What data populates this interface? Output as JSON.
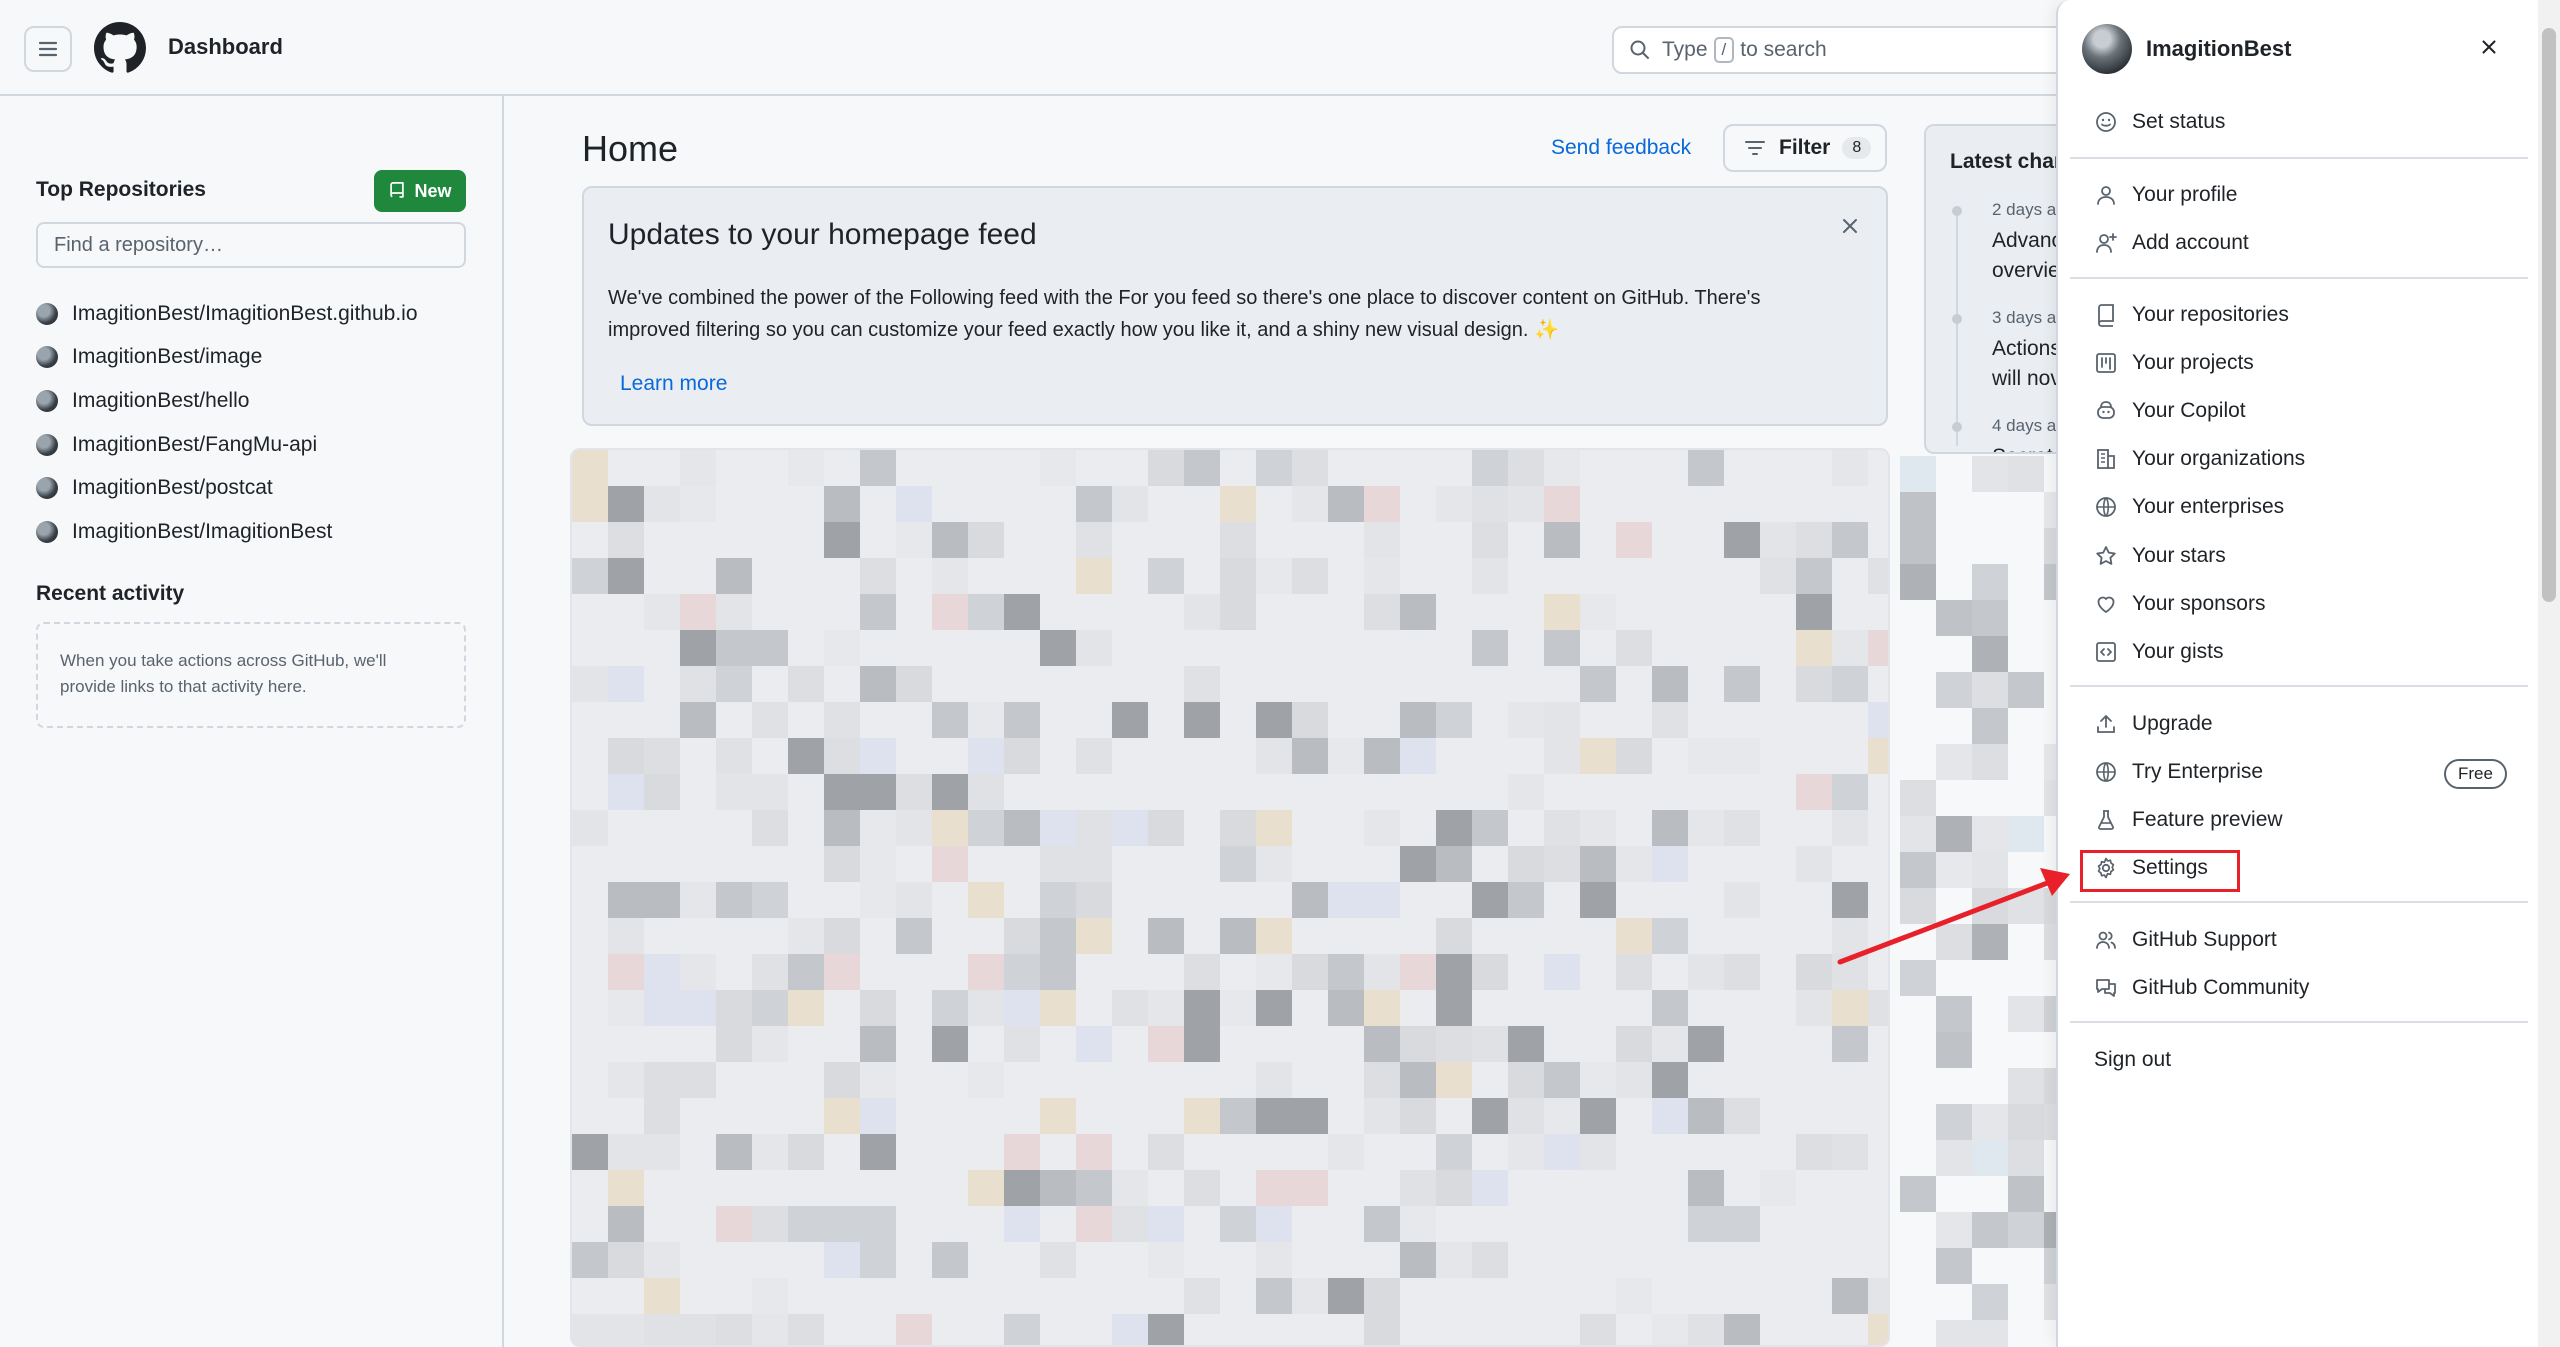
{
  "header": {
    "title": "Dashboard",
    "search_prefix": "Type",
    "search_key": "/",
    "search_suffix": "to search"
  },
  "sidebar": {
    "top_repos_heading": "Top Repositories",
    "new_button": "New",
    "find_placeholder": "Find a repository…",
    "repos": [
      "ImagitionBest/ImagitionBest.github.io",
      "ImagitionBest/image",
      "ImagitionBest/hello",
      "ImagitionBest/FangMu-api",
      "ImagitionBest/postcat",
      "ImagitionBest/ImagitionBest"
    ],
    "recent_heading": "Recent activity",
    "recent_empty": "When you take actions across GitHub, we'll provide links to that activity here."
  },
  "main": {
    "home_title": "Home",
    "send_feedback": "Send feedback",
    "filter_label": "Filter",
    "filter_count": "8",
    "updates": {
      "title": "Updates to your homepage feed",
      "body": "We've combined the power of the Following feed with the For you feed so there's one place to discover content on GitHub. There's improved filtering so you can customize your feed exactly how you like it, and a shiny new visual design. ✨",
      "learn_more": "Learn more"
    },
    "latest": {
      "title": "Latest chan",
      "items": [
        {
          "date": "2 days a",
          "line1": "Advanc",
          "line2": "overvie"
        },
        {
          "date": "3 days a",
          "line1": "Actions",
          "line2": "will nov"
        },
        {
          "date": "4 days a",
          "line1": "Secret",
          "line2": ""
        }
      ]
    }
  },
  "user_menu": {
    "username": "ImagitionBest",
    "items": [
      {
        "label": "Set status",
        "icon": "smiley-icon"
      },
      {
        "label": "Your profile",
        "icon": "person-icon"
      },
      {
        "label": "Add account",
        "icon": "person-add-icon"
      },
      {
        "label": "Your repositories",
        "icon": "repo-icon"
      },
      {
        "label": "Your projects",
        "icon": "project-icon"
      },
      {
        "label": "Your Copilot",
        "icon": "copilot-icon"
      },
      {
        "label": "Your organizations",
        "icon": "organization-icon"
      },
      {
        "label": "Your enterprises",
        "icon": "globe-icon"
      },
      {
        "label": "Your stars",
        "icon": "star-icon"
      },
      {
        "label": "Your sponsors",
        "icon": "heart-icon"
      },
      {
        "label": "Your gists",
        "icon": "code-square-icon"
      },
      {
        "label": "Upgrade",
        "icon": "upload-icon"
      },
      {
        "label": "Try Enterprise",
        "icon": "globe-icon"
      },
      {
        "label": "Feature preview",
        "icon": "beaker-icon"
      },
      {
        "label": "Settings",
        "icon": "gear-icon"
      },
      {
        "label": "GitHub Support",
        "icon": "people-icon"
      },
      {
        "label": "GitHub Community",
        "icon": "comment-discussion-icon"
      },
      {
        "label": "Sign out",
        "icon": ""
      }
    ],
    "free_badge": "Free"
  },
  "annotation": {
    "highlight_color": "#e8202a"
  },
  "colors": {
    "accent_link": "#0969da",
    "new_button_bg": "#1f883d",
    "page_bg": "#f6f8fa"
  }
}
